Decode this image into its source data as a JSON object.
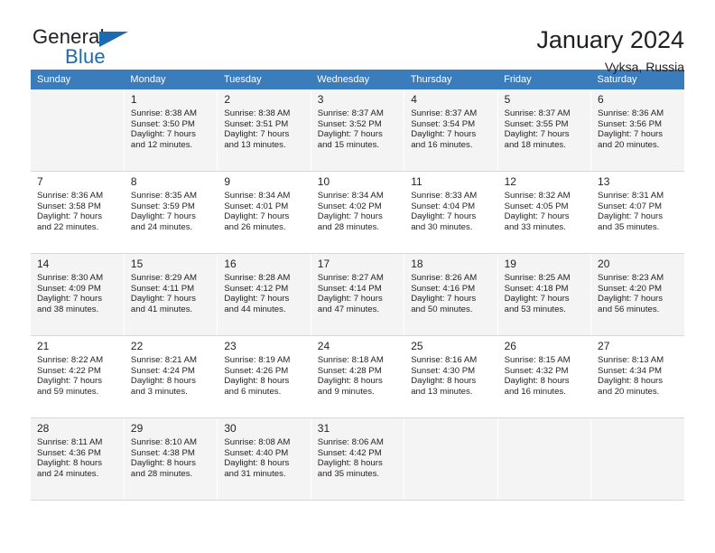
{
  "brand": {
    "name_part1": "General",
    "name_part2": "Blue",
    "accent_color": "#1c6bb0"
  },
  "header": {
    "title": "January 2024",
    "location": "Vyksa, Russia"
  },
  "theme": {
    "header_row_background": "#3b7cbd",
    "header_row_text": "#ffffff",
    "alt_row_background": "#f4f4f4",
    "text_color": "#231f20"
  },
  "calendar": {
    "weekday_headers": [
      "Sunday",
      "Monday",
      "Tuesday",
      "Wednesday",
      "Thursday",
      "Friday",
      "Saturday"
    ],
    "weeks": [
      [
        {
          "day": "",
          "lines": []
        },
        {
          "day": "1",
          "lines": [
            "Sunrise: 8:38 AM",
            "Sunset: 3:50 PM",
            "Daylight: 7 hours",
            "and 12 minutes."
          ]
        },
        {
          "day": "2",
          "lines": [
            "Sunrise: 8:38 AM",
            "Sunset: 3:51 PM",
            "Daylight: 7 hours",
            "and 13 minutes."
          ]
        },
        {
          "day": "3",
          "lines": [
            "Sunrise: 8:37 AM",
            "Sunset: 3:52 PM",
            "Daylight: 7 hours",
            "and 15 minutes."
          ]
        },
        {
          "day": "4",
          "lines": [
            "Sunrise: 8:37 AM",
            "Sunset: 3:54 PM",
            "Daylight: 7 hours",
            "and 16 minutes."
          ]
        },
        {
          "day": "5",
          "lines": [
            "Sunrise: 8:37 AM",
            "Sunset: 3:55 PM",
            "Daylight: 7 hours",
            "and 18 minutes."
          ]
        },
        {
          "day": "6",
          "lines": [
            "Sunrise: 8:36 AM",
            "Sunset: 3:56 PM",
            "Daylight: 7 hours",
            "and 20 minutes."
          ]
        }
      ],
      [
        {
          "day": "7",
          "lines": [
            "Sunrise: 8:36 AM",
            "Sunset: 3:58 PM",
            "Daylight: 7 hours",
            "and 22 minutes."
          ]
        },
        {
          "day": "8",
          "lines": [
            "Sunrise: 8:35 AM",
            "Sunset: 3:59 PM",
            "Daylight: 7 hours",
            "and 24 minutes."
          ]
        },
        {
          "day": "9",
          "lines": [
            "Sunrise: 8:34 AM",
            "Sunset: 4:01 PM",
            "Daylight: 7 hours",
            "and 26 minutes."
          ]
        },
        {
          "day": "10",
          "lines": [
            "Sunrise: 8:34 AM",
            "Sunset: 4:02 PM",
            "Daylight: 7 hours",
            "and 28 minutes."
          ]
        },
        {
          "day": "11",
          "lines": [
            "Sunrise: 8:33 AM",
            "Sunset: 4:04 PM",
            "Daylight: 7 hours",
            "and 30 minutes."
          ]
        },
        {
          "day": "12",
          "lines": [
            "Sunrise: 8:32 AM",
            "Sunset: 4:05 PM",
            "Daylight: 7 hours",
            "and 33 minutes."
          ]
        },
        {
          "day": "13",
          "lines": [
            "Sunrise: 8:31 AM",
            "Sunset: 4:07 PM",
            "Daylight: 7 hours",
            "and 35 minutes."
          ]
        }
      ],
      [
        {
          "day": "14",
          "lines": [
            "Sunrise: 8:30 AM",
            "Sunset: 4:09 PM",
            "Daylight: 7 hours",
            "and 38 minutes."
          ]
        },
        {
          "day": "15",
          "lines": [
            "Sunrise: 8:29 AM",
            "Sunset: 4:11 PM",
            "Daylight: 7 hours",
            "and 41 minutes."
          ]
        },
        {
          "day": "16",
          "lines": [
            "Sunrise: 8:28 AM",
            "Sunset: 4:12 PM",
            "Daylight: 7 hours",
            "and 44 minutes."
          ]
        },
        {
          "day": "17",
          "lines": [
            "Sunrise: 8:27 AM",
            "Sunset: 4:14 PM",
            "Daylight: 7 hours",
            "and 47 minutes."
          ]
        },
        {
          "day": "18",
          "lines": [
            "Sunrise: 8:26 AM",
            "Sunset: 4:16 PM",
            "Daylight: 7 hours",
            "and 50 minutes."
          ]
        },
        {
          "day": "19",
          "lines": [
            "Sunrise: 8:25 AM",
            "Sunset: 4:18 PM",
            "Daylight: 7 hours",
            "and 53 minutes."
          ]
        },
        {
          "day": "20",
          "lines": [
            "Sunrise: 8:23 AM",
            "Sunset: 4:20 PM",
            "Daylight: 7 hours",
            "and 56 minutes."
          ]
        }
      ],
      [
        {
          "day": "21",
          "lines": [
            "Sunrise: 8:22 AM",
            "Sunset: 4:22 PM",
            "Daylight: 7 hours",
            "and 59 minutes."
          ]
        },
        {
          "day": "22",
          "lines": [
            "Sunrise: 8:21 AM",
            "Sunset: 4:24 PM",
            "Daylight: 8 hours",
            "and 3 minutes."
          ]
        },
        {
          "day": "23",
          "lines": [
            "Sunrise: 8:19 AM",
            "Sunset: 4:26 PM",
            "Daylight: 8 hours",
            "and 6 minutes."
          ]
        },
        {
          "day": "24",
          "lines": [
            "Sunrise: 8:18 AM",
            "Sunset: 4:28 PM",
            "Daylight: 8 hours",
            "and 9 minutes."
          ]
        },
        {
          "day": "25",
          "lines": [
            "Sunrise: 8:16 AM",
            "Sunset: 4:30 PM",
            "Daylight: 8 hours",
            "and 13 minutes."
          ]
        },
        {
          "day": "26",
          "lines": [
            "Sunrise: 8:15 AM",
            "Sunset: 4:32 PM",
            "Daylight: 8 hours",
            "and 16 minutes."
          ]
        },
        {
          "day": "27",
          "lines": [
            "Sunrise: 8:13 AM",
            "Sunset: 4:34 PM",
            "Daylight: 8 hours",
            "and 20 minutes."
          ]
        }
      ],
      [
        {
          "day": "28",
          "lines": [
            "Sunrise: 8:11 AM",
            "Sunset: 4:36 PM",
            "Daylight: 8 hours",
            "and 24 minutes."
          ]
        },
        {
          "day": "29",
          "lines": [
            "Sunrise: 8:10 AM",
            "Sunset: 4:38 PM",
            "Daylight: 8 hours",
            "and 28 minutes."
          ]
        },
        {
          "day": "30",
          "lines": [
            "Sunrise: 8:08 AM",
            "Sunset: 4:40 PM",
            "Daylight: 8 hours",
            "and 31 minutes."
          ]
        },
        {
          "day": "31",
          "lines": [
            "Sunrise: 8:06 AM",
            "Sunset: 4:42 PM",
            "Daylight: 8 hours",
            "and 35 minutes."
          ]
        },
        {
          "day": "",
          "lines": []
        },
        {
          "day": "",
          "lines": []
        },
        {
          "day": "",
          "lines": []
        }
      ]
    ]
  }
}
